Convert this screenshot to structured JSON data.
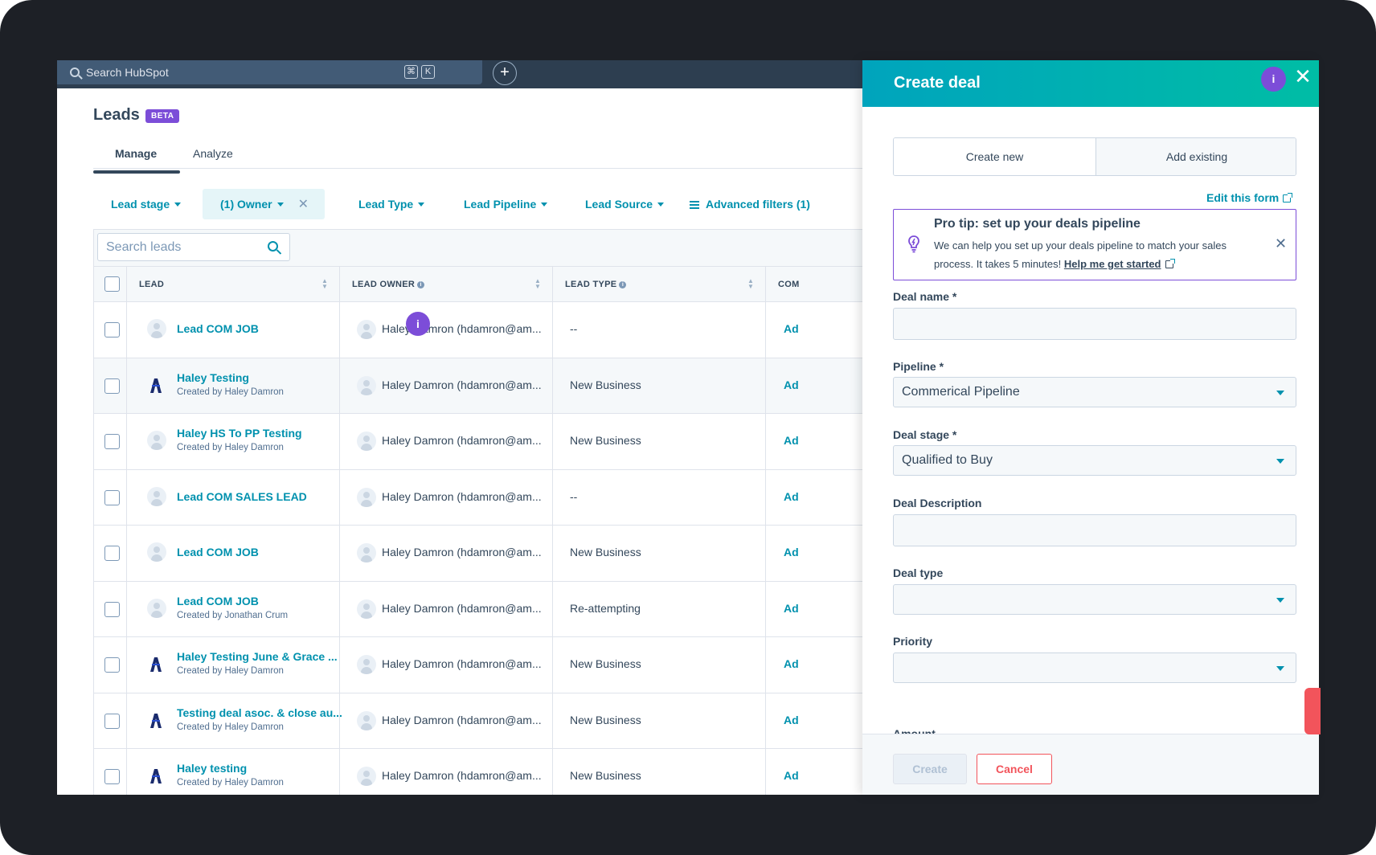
{
  "topnav": {
    "search_placeholder": "Search HubSpot",
    "shortcut_key1": "⌘",
    "shortcut_key2": "K",
    "plus_label": "+"
  },
  "header": {
    "title": "Leads",
    "badge": "BETA",
    "tabs": [
      {
        "label": "Manage",
        "active": true
      },
      {
        "label": "Analyze",
        "active": false
      }
    ]
  },
  "filters": [
    {
      "label": "Lead stage"
    },
    {
      "label": "(1) Owner",
      "selected": true
    },
    {
      "label": "Lead Type"
    },
    {
      "label": "Lead Pipeline"
    },
    {
      "label": "Lead Source"
    },
    {
      "label": "Advanced filters (1)"
    }
  ],
  "table": {
    "search_placeholder": "Search leads",
    "columns": [
      "LEAD",
      "LEAD OWNER",
      "LEAD TYPE",
      "COM"
    ],
    "rows": [
      {
        "lead": "Lead COM JOB",
        "sub": "",
        "avatar": "person",
        "owner": "Haley Damron (hdamron@am...",
        "type": "--",
        "action": "Ad"
      },
      {
        "lead": "Haley Testing",
        "sub": "Created by Haley Damron",
        "avatar": "logo",
        "owner": "Haley Damron (hdamron@am...",
        "type": "New Business",
        "action": "Ad"
      },
      {
        "lead": "Haley HS To PP Testing",
        "sub": "Created by Haley Damron",
        "avatar": "person",
        "owner": "Haley Damron (hdamron@am...",
        "type": "New Business",
        "action": "Ad"
      },
      {
        "lead": "Lead COM SALES LEAD",
        "sub": "",
        "avatar": "person",
        "owner": "Haley Damron (hdamron@am...",
        "type": "--",
        "action": "Ad"
      },
      {
        "lead": "Lead COM JOB",
        "sub": "",
        "avatar": "person",
        "owner": "Haley Damron (hdamron@am...",
        "type": "New Business",
        "action": "Ad"
      },
      {
        "lead": "Lead COM JOB",
        "sub": "Created by Jonathan Crum",
        "avatar": "person",
        "owner": "Haley Damron (hdamron@am...",
        "type": "Re-attempting",
        "action": "Ad"
      },
      {
        "lead": "Haley Testing June & Grace ...",
        "sub": "Created by Haley Damron",
        "avatar": "logo",
        "owner": "Haley Damron (hdamron@am...",
        "type": "New Business",
        "action": "Ad"
      },
      {
        "lead": "Testing deal asoc. & close au...",
        "sub": "Created by Haley Damron",
        "avatar": "logo",
        "owner": "Haley Damron (hdamron@am...",
        "type": "New Business",
        "action": "Ad"
      },
      {
        "lead": "Haley testing",
        "sub": "Created by Haley Damron",
        "avatar": "logo",
        "owner": "Haley Damron (hdamron@am...",
        "type": "New Business",
        "action": "Ad"
      }
    ]
  },
  "tour_marker": "i",
  "panel": {
    "title": "Create deal",
    "info_label": "i",
    "close_label": "✕",
    "segment": {
      "create_new": "Create new",
      "add_existing": "Add existing"
    },
    "edit_form": "Edit this form",
    "protip": {
      "title": "Pro tip: set up your deals pipeline",
      "body": "We can help you set up your deals pipeline to match your sales process. It takes 5 minutes! ",
      "link": "Help me get started",
      "close": "✕"
    },
    "fields": {
      "deal_name": {
        "label": "Deal name *",
        "value": ""
      },
      "pipeline": {
        "label": "Pipeline *",
        "value": "Commerical Pipeline"
      },
      "deal_stage": {
        "label": "Deal stage *",
        "value": "Qualified to Buy"
      },
      "deal_description": {
        "label": "Deal Description",
        "value": ""
      },
      "deal_type": {
        "label": "Deal type",
        "value": ""
      },
      "priority": {
        "label": "Priority",
        "value": ""
      },
      "amount": {
        "label": "Amount"
      }
    },
    "buttons": {
      "create": "Create",
      "cancel": "Cancel"
    }
  },
  "colors": {
    "accent": "#0091ae",
    "panel_header_start": "#00a4bd",
    "panel_header_end": "#00bda5",
    "beta_badge": "#7c4dd8",
    "cancel": "#f2545b",
    "nav_bg": "#2d3e50"
  }
}
